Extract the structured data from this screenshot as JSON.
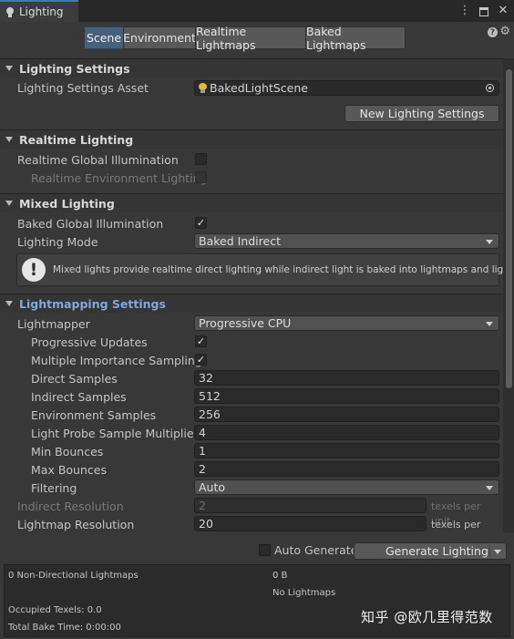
{
  "window": {
    "tab_title": "Lighting",
    "icons": [
      "kebab-menu-icon",
      "maximize-icon",
      "close-icon"
    ]
  },
  "toolbar": {
    "tabs": [
      "Scene",
      "Environment",
      "Realtime Lightmaps",
      "Baked Lightmaps"
    ],
    "active_tab": "Scene",
    "help_icon": "?",
    "settings_icon": "gear-icon"
  },
  "lighting_settings": {
    "header": "Lighting Settings",
    "asset_label": "Lighting Settings Asset",
    "asset_value": "BakedLightScene",
    "new_button": "New Lighting Settings"
  },
  "realtime_lighting": {
    "header": "Realtime Lighting",
    "rgi_label": "Realtime Global Illumination",
    "rgi_checked": false,
    "env_label": "Realtime Environment Lighting",
    "env_checked": false
  },
  "mixed_lighting": {
    "header": "Mixed Lighting",
    "bgi_label": "Baked Global Illumination",
    "bgi_checked": true,
    "mode_label": "Lighting Mode",
    "mode_value": "Baked Indirect",
    "help_text": "Mixed lights provide realtime direct lighting while indirect light is baked into lightmaps and light probes.",
    "help_icon": "!"
  },
  "lightmapping": {
    "header": "Lightmapping Settings",
    "lightmapper_label": "Lightmapper",
    "lightmapper_value": "Progressive CPU",
    "progressive_updates_label": "Progressive Updates",
    "progressive_updates_checked": true,
    "mis_label": "Multiple Importance Sampling",
    "mis_checked": true,
    "direct_samples_label": "Direct Samples",
    "direct_samples": "32",
    "indirect_samples_label": "Indirect Samples",
    "indirect_samples": "512",
    "env_samples_label": "Environment Samples",
    "env_samples": "256",
    "probe_mult_label": "Light Probe Sample Multiplier",
    "probe_mult": "4",
    "min_bounces_label": "Min Bounces",
    "min_bounces": "1",
    "max_bounces_label": "Max Bounces",
    "max_bounces": "2",
    "filtering_label": "Filtering",
    "filtering_value": "Auto",
    "indirect_res_label": "Indirect Resolution",
    "indirect_res": "2",
    "indirect_res_unit": "texels per unit",
    "lightmap_res_label": "Lightmap Resolution",
    "lightmap_res": "20",
    "lightmap_res_unit": "texels per unit",
    "check_mark": "✓"
  },
  "generate": {
    "auto_label": "Auto Generate",
    "auto_checked": false,
    "button": "Generate Lighting"
  },
  "stats": {
    "lightmaps": "0 Non-Directional Lightmaps",
    "size": "0 B",
    "no_lightmaps": "No Lightmaps",
    "occupied": "Occupied Texels: 0.0",
    "bake_time": "Total Bake Time: 0:00:00"
  },
  "watermark": "知乎 @欧几里得范数"
}
